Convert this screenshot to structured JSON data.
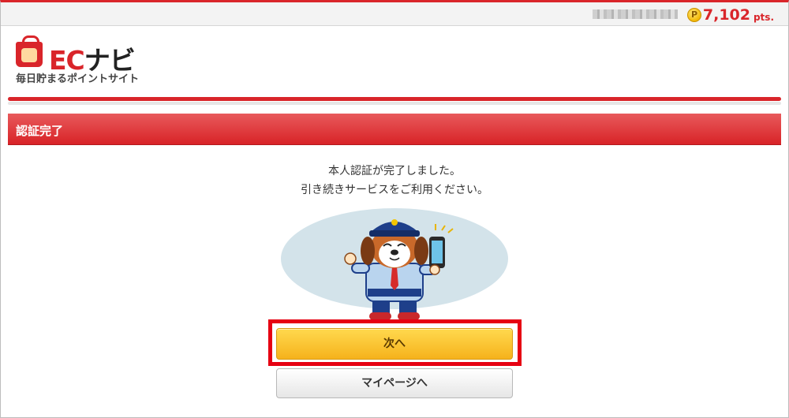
{
  "header": {
    "points_value": "7,102",
    "points_unit": "pts.",
    "coin_symbol": "P"
  },
  "logo": {
    "brand": "EC",
    "brand_suffix": "ナビ",
    "tagline": "毎日貯まるポイントサイト"
  },
  "section": {
    "title": "認証完了"
  },
  "main": {
    "message_line1": "本人認証が完了しました。",
    "message_line2": "引き続きサービスをご利用ください。"
  },
  "buttons": {
    "next_label": "次へ",
    "mypage_label": "マイページへ"
  },
  "colors": {
    "brand_red": "#d9252a",
    "button_yellow": "#f6b21c",
    "highlight_red": "#e60012"
  }
}
